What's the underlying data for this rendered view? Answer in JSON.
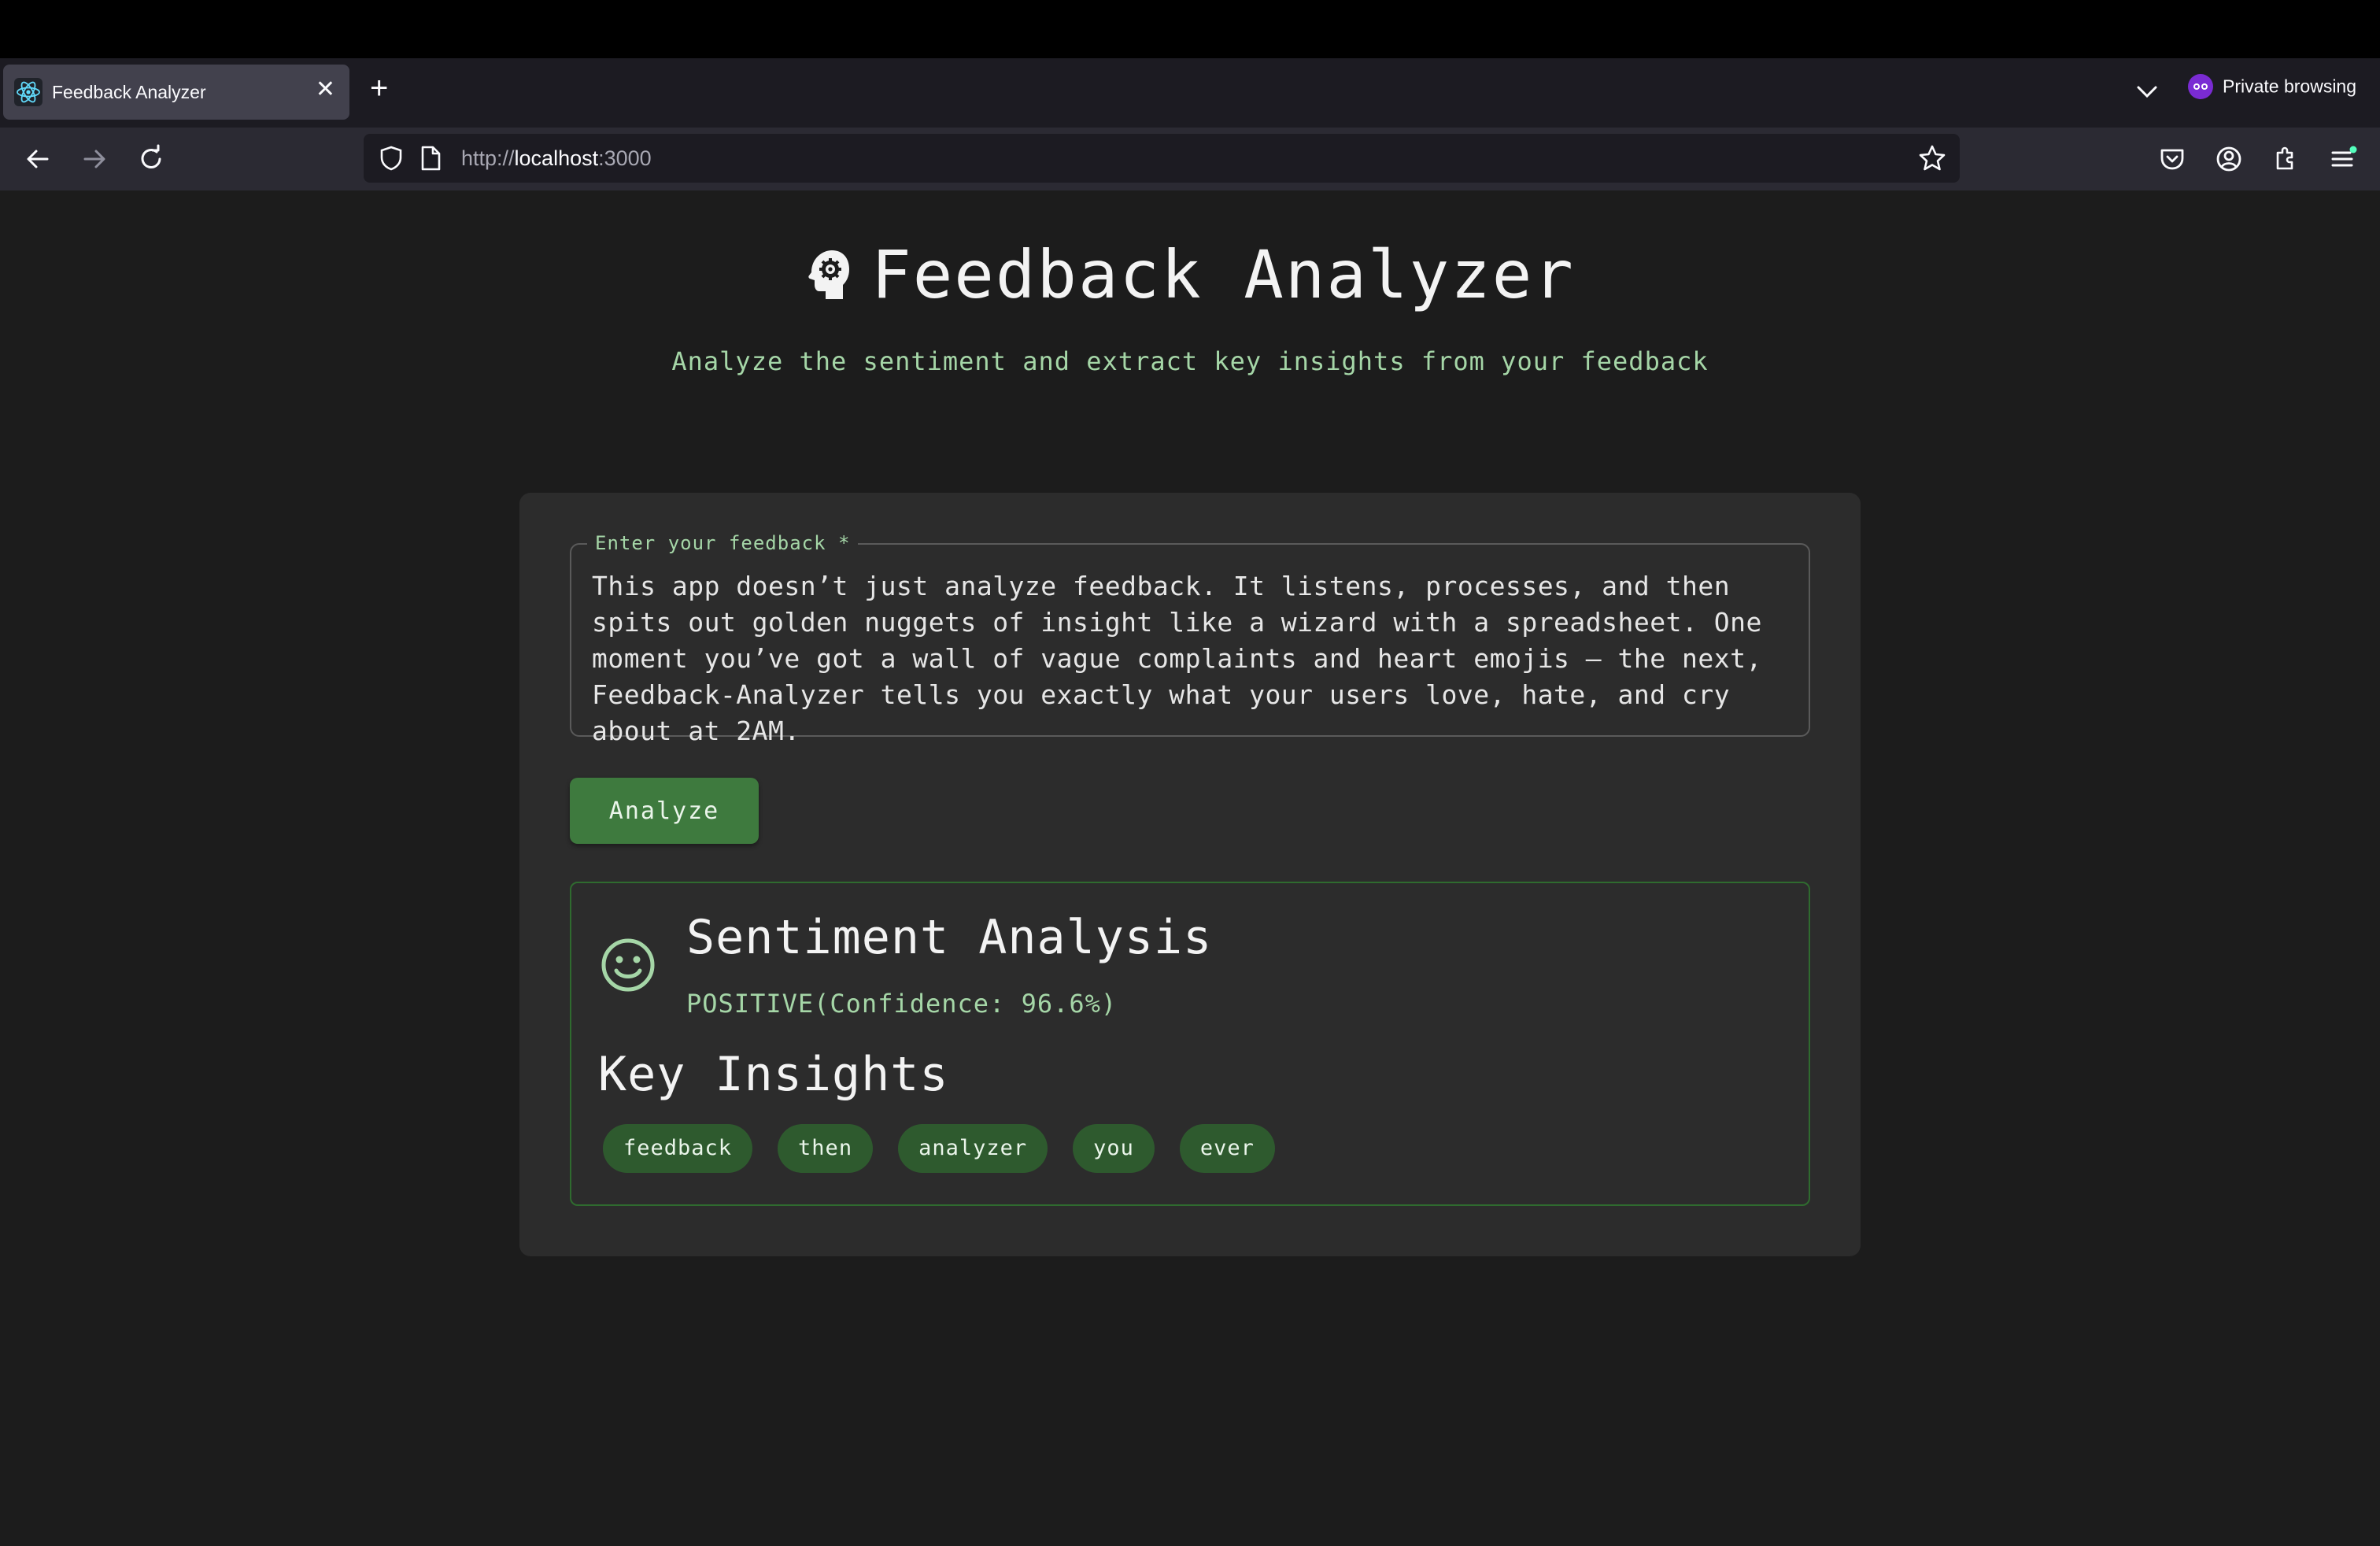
{
  "browser": {
    "tab_title": "Feedback Analyzer",
    "new_tab": "+",
    "private_label": "Private browsing",
    "url_scheme": "http://",
    "url_host": "localhost",
    "url_port": ":3000"
  },
  "header": {
    "title": "Feedback Analyzer",
    "subtitle": "Analyze the sentiment and extract key insights from your feedback"
  },
  "form": {
    "label": "Enter your feedback *",
    "value": "This app doesn’t just analyze feedback. It listens, processes, and then spits out golden nuggets of insight like a wizard with a spreadsheet. One moment you’ve got a wall of vague complaints and heart emojis — the next, Feedback-Analyzer tells you exactly what your users love, hate, and cry about at 2AM.",
    "button_label": "Analyze"
  },
  "results": {
    "sentiment_title": "Sentiment Analysis",
    "sentiment_value": "POSITIVE(Confidence: 96.6%)",
    "insights_title": "Key Insights",
    "keywords": [
      "feedback",
      "then",
      "analyzer",
      "you",
      "ever"
    ]
  },
  "colors": {
    "accent_green": "#a5d6a7",
    "button_green": "#3e7a3e",
    "chip_green": "#2e5a2e",
    "background": "#1c1c1c",
    "card": "#2c2c2c"
  }
}
